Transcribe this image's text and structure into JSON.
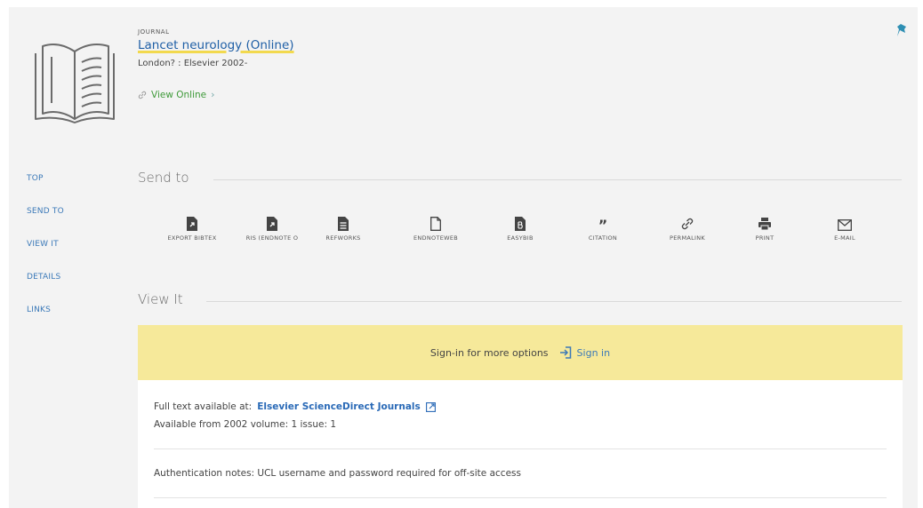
{
  "record": {
    "type": "JOURNAL",
    "title": "Lancet neurology (Online)",
    "publication": "London? : Elsevier 2002-",
    "view_online": "View Online"
  },
  "icons": {
    "book": "open-book-icon",
    "pin": "pin-icon",
    "link": "link-icon",
    "chevron": "chevron-right-icon",
    "signin": "sign-in-icon",
    "external": "external-link-icon"
  },
  "nav": {
    "items": [
      "TOP",
      "SEND TO",
      "VIEW IT",
      "DETAILS",
      "LINKS"
    ]
  },
  "send_to": {
    "title": "Send to",
    "actions": [
      {
        "label": "EXPORT BIBTEX",
        "icon": "export-file-icon"
      },
      {
        "label": "RIS (ENDNOTE O",
        "icon": "export-file-icon"
      },
      {
        "label": "REFWORKS",
        "icon": "document-icon"
      },
      {
        "label": "ENDNOTEWEB",
        "icon": "blank-file-icon"
      },
      {
        "label": "EASYBIB",
        "icon": "easybib-file-icon"
      },
      {
        "label": "CITATION",
        "icon": "quote-icon"
      },
      {
        "label": "PERMALINK",
        "icon": "link-icon"
      },
      {
        "label": "PRINT",
        "icon": "printer-icon"
      },
      {
        "label": "E-MAIL",
        "icon": "envelope-icon"
      }
    ]
  },
  "view_it": {
    "title": "View It",
    "signin_prompt": "Sign-in for more options",
    "signin_link": "Sign in",
    "full_text_label": "Full text available at:",
    "full_text_link": "Elsevier ScienceDirect Journals",
    "availability": "Available from 2002 volume: 1 issue: 1",
    "auth_note": "Authentication notes: UCL username and password required for off-site access"
  },
  "colors": {
    "background": "#f3f3f3",
    "link": "#3b79b8",
    "title_link": "#1f5fa6",
    "title_underline": "#f2d94e",
    "view_online": "#3f9a3a",
    "signin_bar": "#f6e99a",
    "pin": "#2e8fb3"
  }
}
